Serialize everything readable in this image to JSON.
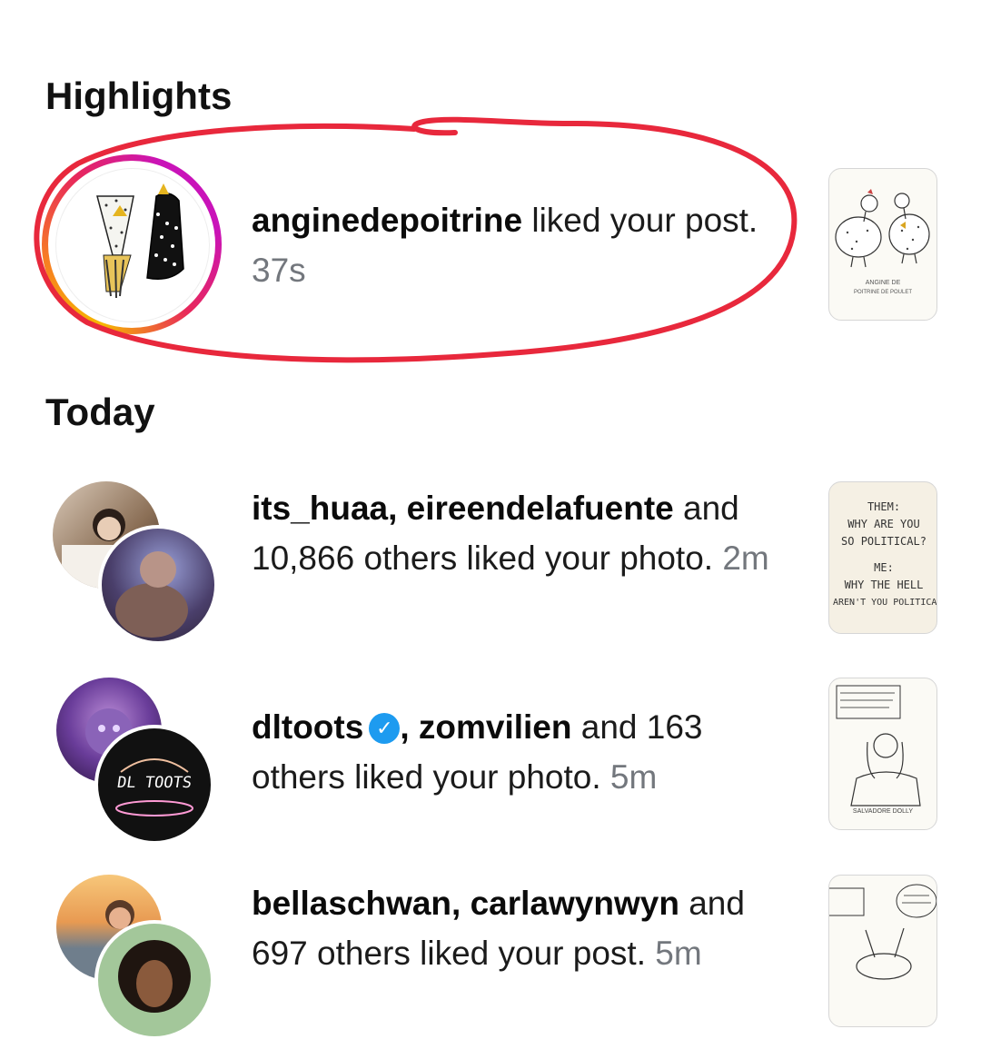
{
  "sections": {
    "highlights": "Highlights",
    "today": "Today"
  },
  "highlight": {
    "user": "anginedepoitrine",
    "action": " liked your post.",
    "time": "37s",
    "thumb_caption_1": "ANGINE DE",
    "thumb_caption_2": "POITRINE DE POULET"
  },
  "notifications": [
    {
      "users": "its_huaa, eireendelafuente",
      "rest": "and 10,866 others liked your photo.",
      "time": "2m",
      "thumb_lines": [
        "THEM:",
        "WHY ARE YOU",
        "SO POLITICAL?",
        "ME:",
        "WHY THE HELL",
        "AREN'T YOU POLITICAL"
      ]
    },
    {
      "user1": "dltoots",
      "user2": "zomvilien",
      "rest": "and 163 others liked your photo.",
      "time": "5m",
      "avatar_text": "DL TOOTS",
      "thumb_caption": "SALVADORE DOLLY"
    },
    {
      "users": "bellaschwan, carlawynwyn",
      "rest": "and 697 others liked your post.",
      "time": "5m"
    }
  ],
  "colors": {
    "red_circle": "#e8283c",
    "story_ring_start": "#f6b800",
    "story_ring_end": "#c913b9",
    "verified": "#1d9bf0",
    "time_gray": "#73777d"
  },
  "icons": [
    "verified-badge-icon"
  ]
}
